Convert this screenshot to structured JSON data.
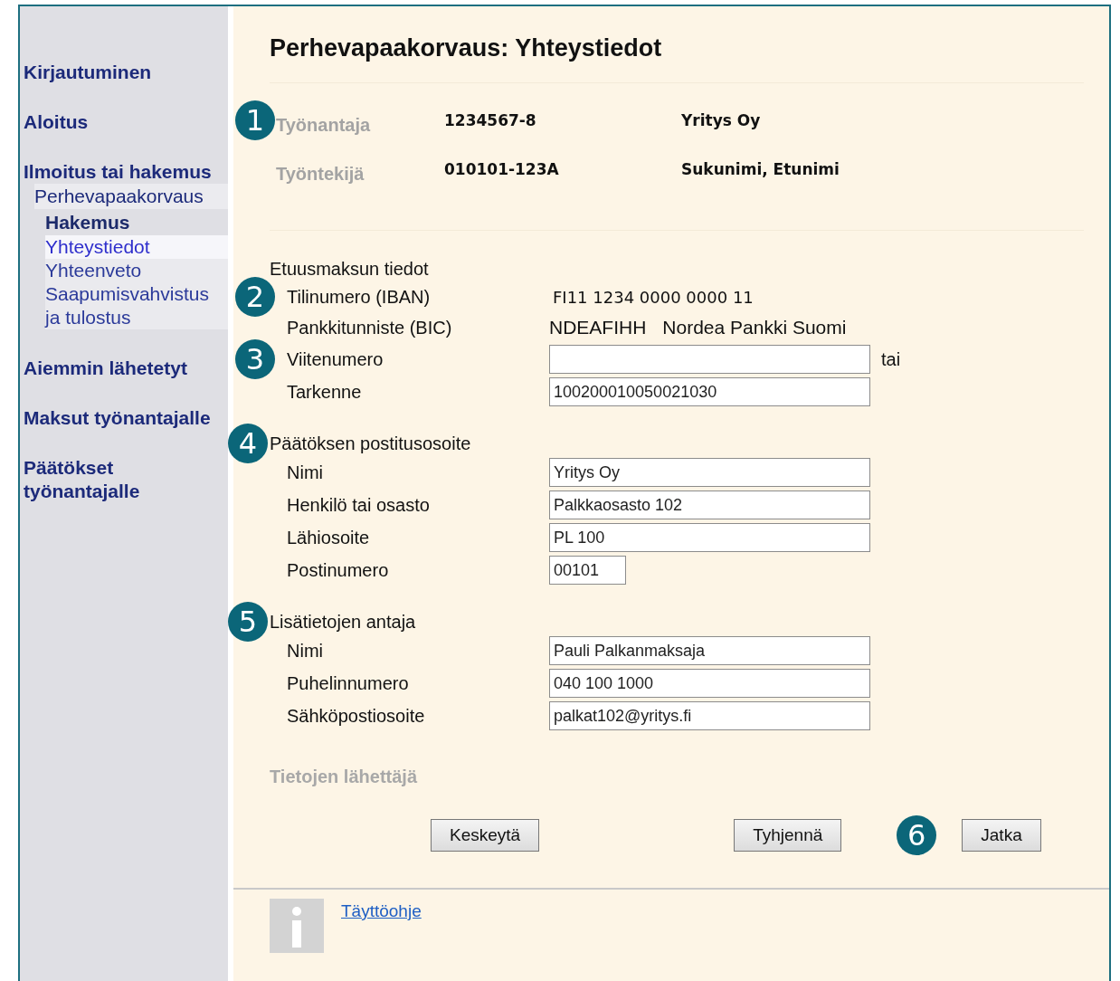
{
  "title": "Perhevapaakorvaus: Yhteystiedot",
  "sidebar": {
    "items": [
      {
        "label": "Kirjautuminen",
        "kind": "section",
        "selected": false
      },
      {
        "label": "Aloitus",
        "kind": "section",
        "selected": false
      },
      {
        "label": "Ilmoitus tai hakemus",
        "kind": "section",
        "selected": false,
        "children": [
          {
            "label": "Perhevapaakorvaus",
            "kind": "group",
            "selected": false,
            "children": [
              {
                "label": "Hakemus",
                "kind": "heading",
                "selected": false
              },
              {
                "label": "Yhteystiedot",
                "kind": "step",
                "selected": true
              },
              {
                "label": "Yhteenveto",
                "kind": "step",
                "selected": false
              },
              {
                "label": "Saapumisvahvistus ja tulostus",
                "kind": "step",
                "selected": false
              }
            ]
          }
        ]
      },
      {
        "label": "Aiemmin lähetetyt",
        "kind": "section",
        "selected": false
      },
      {
        "label": "Maksut työnantajalle",
        "kind": "section",
        "selected": false
      },
      {
        "label": "Päätökset työnantajalle",
        "kind": "section",
        "selected": false
      }
    ]
  },
  "header": [
    {
      "label": "Työnantaja",
      "id": "1234567-8",
      "name": "Yritys Oy",
      "callout": "1"
    },
    {
      "label": "Työntekijä",
      "id": "010101-123A",
      "name": "Sukunimi, Etunimi"
    }
  ],
  "sections": [
    {
      "heading": "Etuusmaksun tiedot",
      "rows": [
        {
          "kind": "text",
          "label": "Tilinumero (IBAN)",
          "values": [
            "FI11 1234 0000 0000 11"
          ],
          "callout": "2"
        },
        {
          "kind": "text",
          "label": "Pankkitunniste (BIC)",
          "values": [
            "NDEAFIHH",
            "Nordea Pankki Suomi"
          ]
        },
        {
          "kind": "input",
          "label": "Viitenumero",
          "suffix": "tai",
          "callout": "3"
        },
        {
          "kind": "input",
          "label": "Tarkenne",
          "value": "100200010050021030"
        }
      ]
    },
    {
      "heading": "Päätöksen postitusosoite",
      "callout": "4",
      "rows": [
        {
          "kind": "input",
          "label": "Nimi",
          "value": "Yritys Oy"
        },
        {
          "kind": "input",
          "label": "Henkilö tai osasto",
          "value": "Palkkaosasto 102"
        },
        {
          "kind": "input",
          "label": "Lähiosoite",
          "value": "PL 100"
        },
        {
          "kind": "short-input",
          "label": "Postinumero",
          "value": "00101"
        }
      ]
    },
    {
      "heading": "Lisätietojen antaja",
      "callout": "5",
      "rows": [
        {
          "kind": "input",
          "label": "Nimi",
          "value": "Pauli Palkanmaksaja"
        },
        {
          "kind": "input",
          "label": "Puhelinnumero",
          "value": "040 100 1000"
        },
        {
          "kind": "input",
          "label": "Sähköpostiosoite",
          "value": "palkat102@yritys.fi"
        }
      ]
    }
  ],
  "sender_heading": "Tietojen lähettäjä",
  "buttons": [
    {
      "label": "Keskeytä"
    },
    {
      "label": "Tyhjennä"
    },
    {
      "label": "Jatka",
      "callout": "6"
    }
  ],
  "help_link": "Täyttöohje"
}
